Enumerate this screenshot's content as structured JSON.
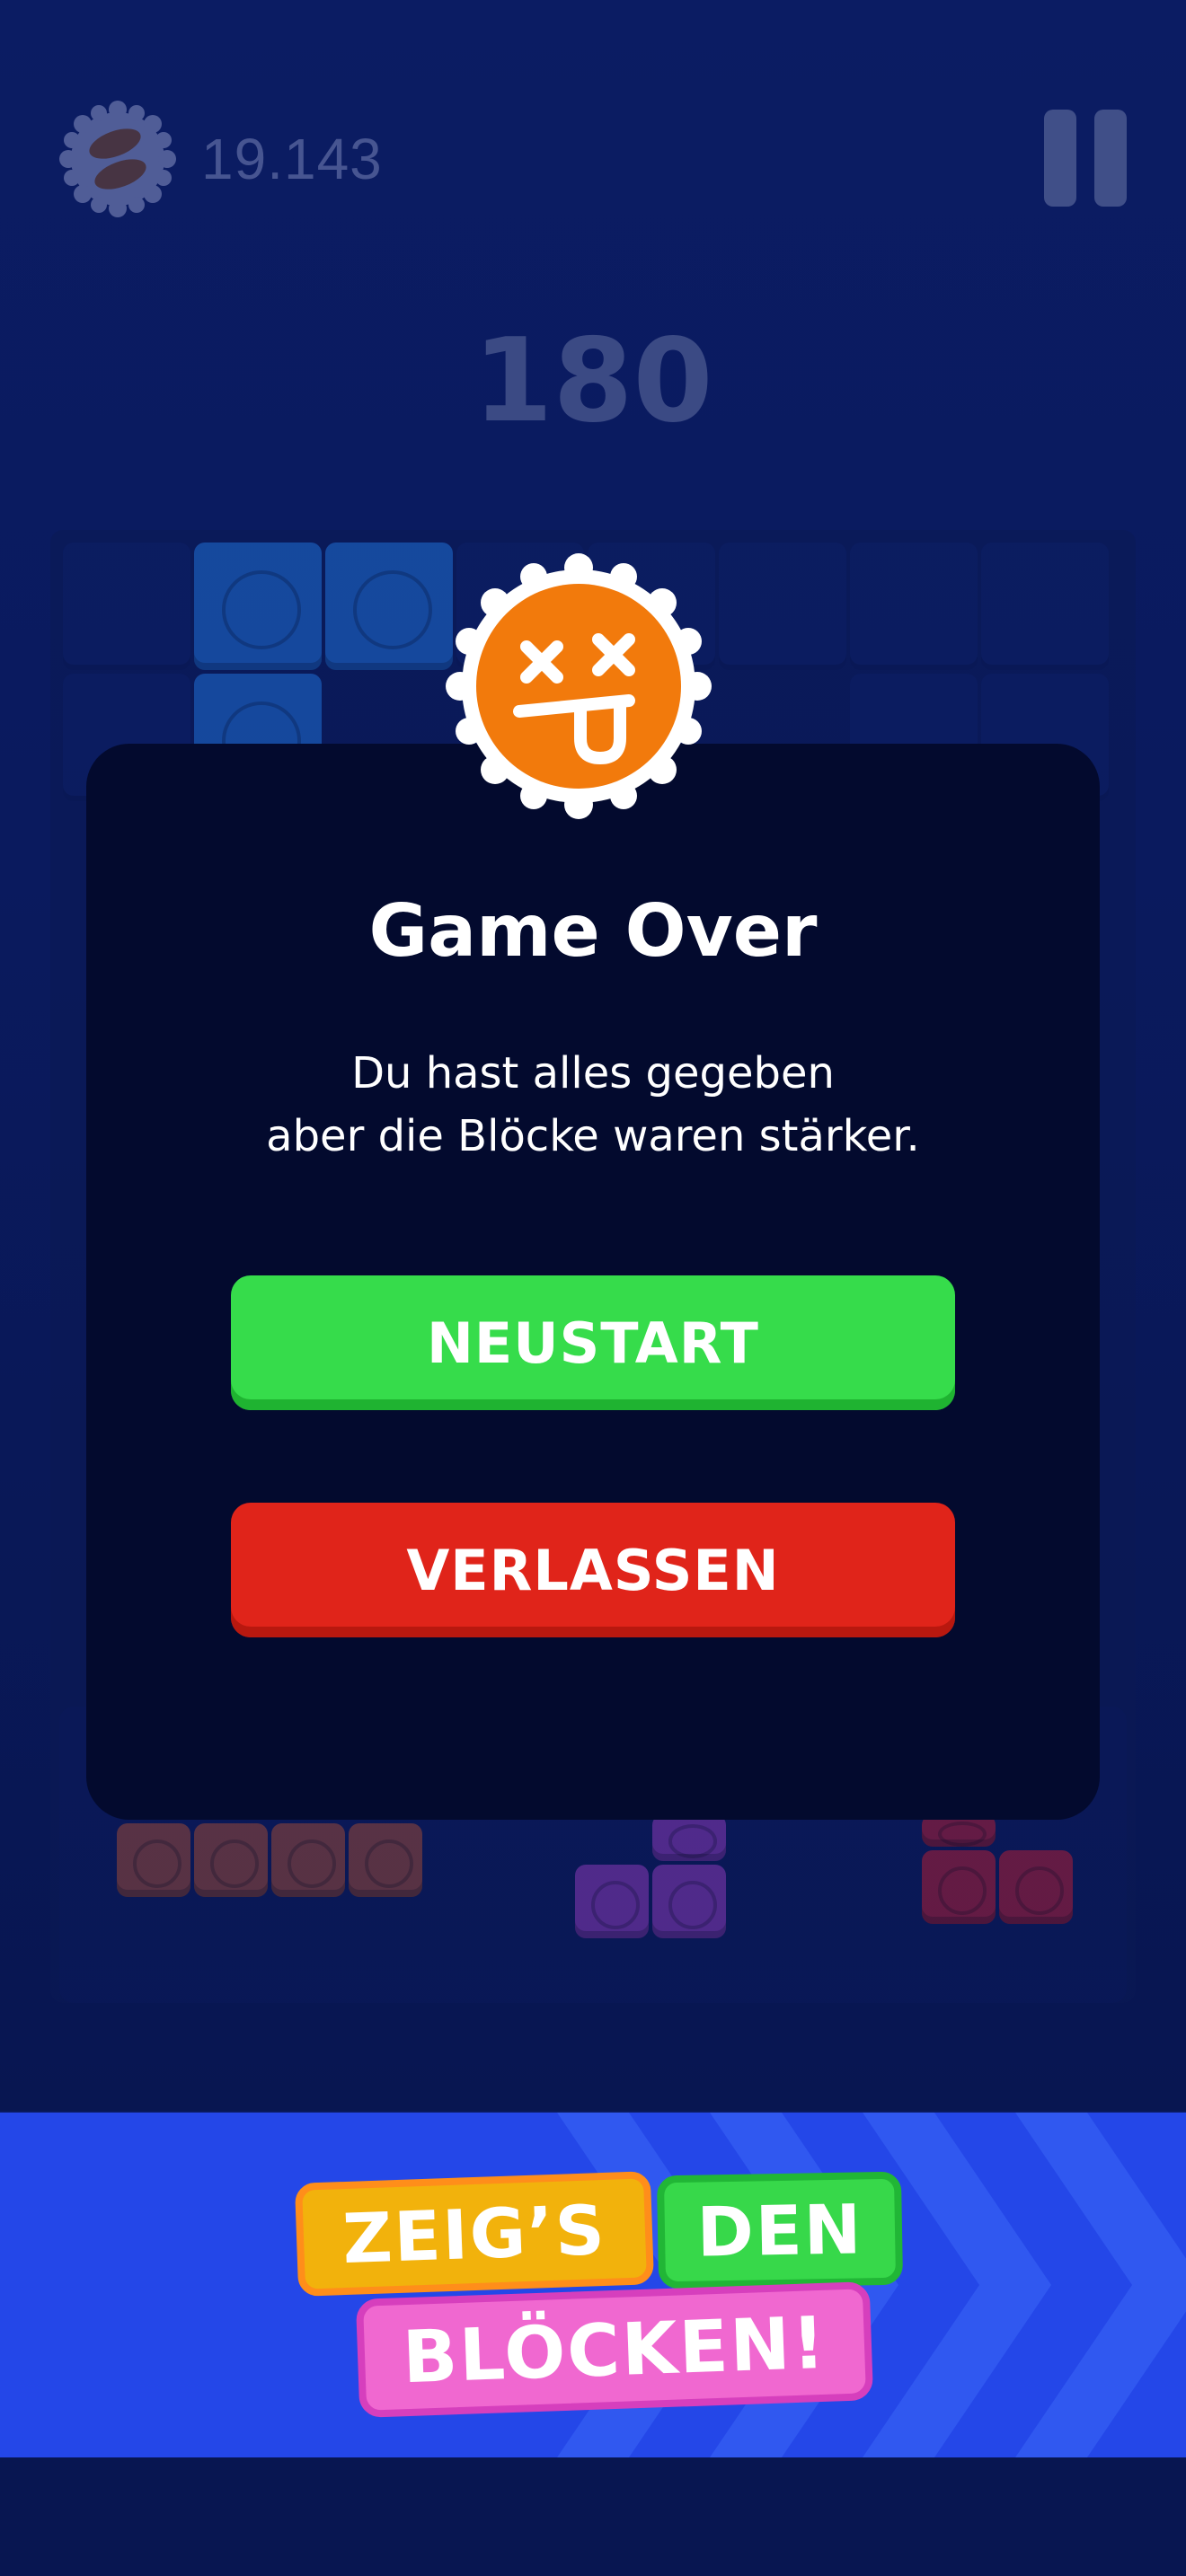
{
  "hud": {
    "coins": "19.143",
    "score": "180",
    "coin_icon": "coin-icon",
    "pause_icon": "pause-icon"
  },
  "dialog": {
    "title": "Game Over",
    "message_line1": "Du hast alles gegeben",
    "message_line2": "aber die Blöcke waren stärker.",
    "restart_label": "NEUSTART",
    "leave_label": "VERLASSEN",
    "badge_icon": "dizzy-face-icon"
  },
  "promo": {
    "word1": "ZEIG’S",
    "word2": "DEN",
    "word3": "BLÖCKEN!"
  },
  "colors": {
    "restart": "#36dc4b",
    "leave": "#e0241a",
    "badge": "#f27a0c",
    "banner": "#2447e8"
  }
}
